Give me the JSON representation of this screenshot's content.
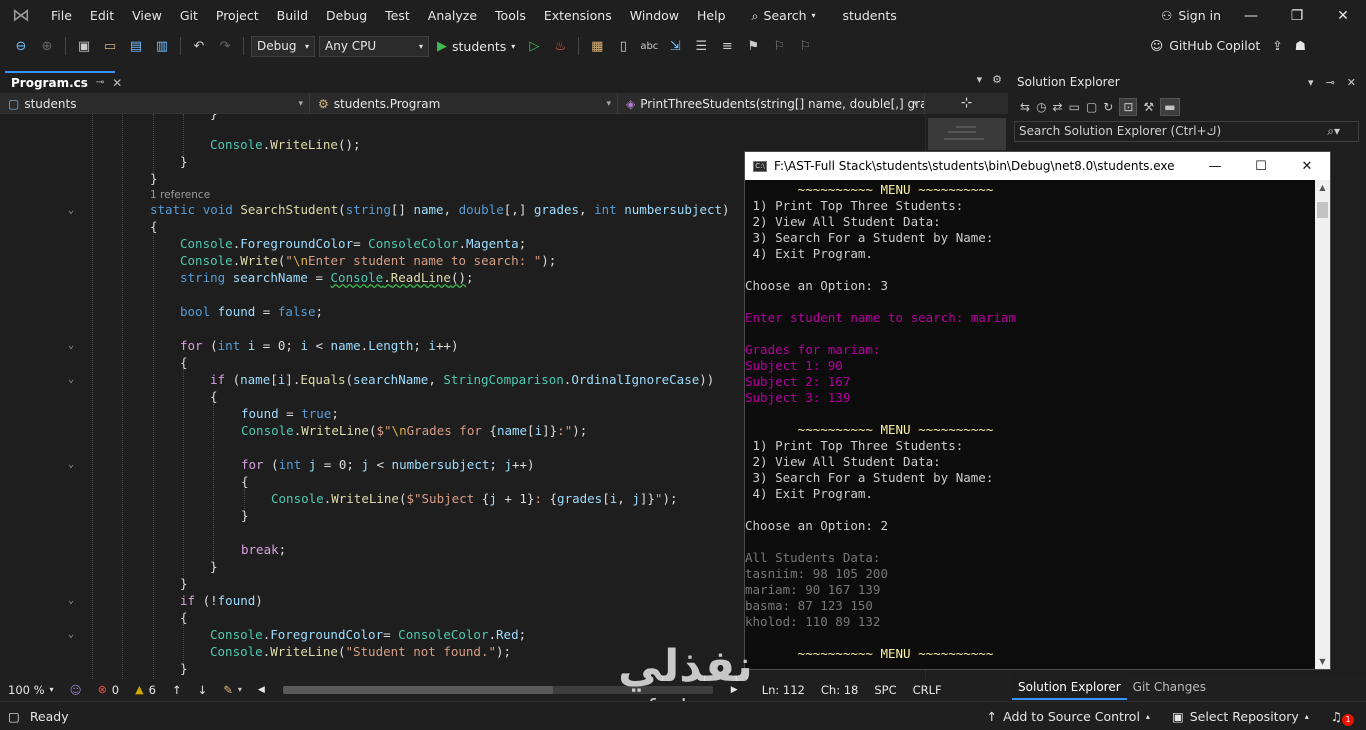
{
  "menubar": {
    "items": [
      "File",
      "Edit",
      "View",
      "Git",
      "Project",
      "Build",
      "Debug",
      "Test",
      "Analyze",
      "Tools",
      "Extensions",
      "Window",
      "Help"
    ],
    "search_label": "Search",
    "solution_name": "students",
    "sign_in": "Sign in"
  },
  "toolbar": {
    "config": "Debug",
    "platform": "Any CPU",
    "run_target": "students",
    "copilot": "GitHub Copilot"
  },
  "editor": {
    "tab_name": "Program.cs",
    "nav_project": "students",
    "nav_class": "students.Program",
    "nav_member": "PrintThreeStudents(string[] name, double[,] grades,",
    "reference_label": "1 reference"
  },
  "editor_status": {
    "zoom": "100 %",
    "errors": "0",
    "warnings": "6",
    "line": "Ln: 112",
    "col": "Ch: 18",
    "whitespace": "SPC",
    "line_ending": "CRLF"
  },
  "solution_explorer": {
    "title": "Solution Explorer",
    "search_placeholder": "Search Solution Explorer (Ctrl+ك)",
    "tabs": [
      "Solution Explorer",
      "Git Changes"
    ]
  },
  "console": {
    "title": "F:\\AST-Full Stack\\students\\students\\bin\\Debug\\net8.0\\students.exe",
    "lines": [
      {
        "text": "       ~~~~~~~~~~ MENU ~~~~~~~~~~",
        "color": "yellow"
      },
      {
        "text": " 1) Print Top Three Students:",
        "color": "white"
      },
      {
        "text": " 2) View All Student Data:",
        "color": "white"
      },
      {
        "text": " 3) Search For a Student by Name:",
        "color": "white"
      },
      {
        "text": " 4) Exit Program.",
        "color": "white"
      },
      {
        "text": "",
        "color": "white"
      },
      {
        "text": "Choose an Option: 3",
        "color": "white"
      },
      {
        "text": "",
        "color": "white"
      },
      {
        "text": "Enter student name to search: mariam",
        "color": "magenta"
      },
      {
        "text": "",
        "color": "white"
      },
      {
        "text": "Grades for mariam:",
        "color": "magenta"
      },
      {
        "text": "Subject 1: 90",
        "color": "magenta"
      },
      {
        "text": "Subject 2: 167",
        "color": "magenta"
      },
      {
        "text": "Subject 3: 139",
        "color": "magenta"
      },
      {
        "text": "",
        "color": "white"
      },
      {
        "text": "       ~~~~~~~~~~ MENU ~~~~~~~~~~",
        "color": "yellow"
      },
      {
        "text": " 1) Print Top Three Students:",
        "color": "white"
      },
      {
        "text": " 2) View All Student Data:",
        "color": "white"
      },
      {
        "text": " 3) Search For a Student by Name:",
        "color": "white"
      },
      {
        "text": " 4) Exit Program.",
        "color": "white"
      },
      {
        "text": "",
        "color": "white"
      },
      {
        "text": "Choose an Option: 2",
        "color": "white"
      },
      {
        "text": "",
        "color": "white"
      },
      {
        "text": "All Students Data:",
        "color": "gray"
      },
      {
        "text": "tasniim: 98 105 200",
        "color": "gray"
      },
      {
        "text": "mariam: 90 167 139",
        "color": "gray"
      },
      {
        "text": "basma: 87 123 150",
        "color": "gray"
      },
      {
        "text": "kholod: 110 89 132",
        "color": "gray"
      },
      {
        "text": "",
        "color": "white"
      },
      {
        "text": "       ~~~~~~~~~~ MENU ~~~~~~~~~~",
        "color": "yellow"
      }
    ]
  },
  "watermark": {
    "arabic": "نفذلي",
    "latin": "nafezly.com"
  },
  "statusbar": {
    "ready": "Ready",
    "add_source": "Add to Source Control",
    "select_repo": "Select Repository",
    "notifications": "1"
  },
  "colors": {
    "accent": "#3794ff",
    "keyword": "#569cd6",
    "type": "#4ec9b0",
    "method": "#dcdcaa",
    "string": "#d69d85",
    "console_magenta": "#b4009e",
    "console_yellow": "#f9f1a5"
  }
}
